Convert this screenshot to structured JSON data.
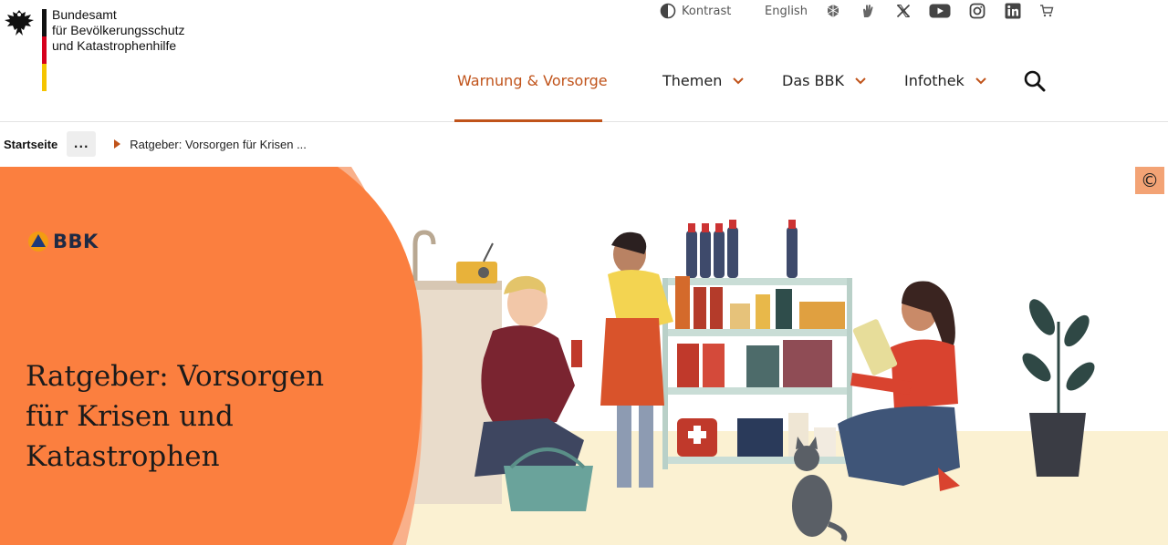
{
  "brand": {
    "line1": "Bundesamt",
    "line2": "für Bevölkerungsschutz",
    "line3": "und Katastrophenhilfe",
    "flag_colors": [
      "#111111",
      "#d6001c",
      "#f5c400"
    ]
  },
  "utility": {
    "contrast_label": "Kontrast",
    "language_label": "English",
    "icons": [
      "sign-language-icon",
      "hand-icon",
      "x-icon",
      "youtube-icon",
      "instagram-icon",
      "linkedin-icon",
      "cart-icon"
    ]
  },
  "nav": {
    "items": [
      {
        "label": "Warnung & Vorsorge",
        "active": true
      },
      {
        "label": "Themen",
        "active": false
      },
      {
        "label": "Das BBK",
        "active": false
      },
      {
        "label": "Infothek",
        "active": false
      }
    ],
    "accent": "#c0531a"
  },
  "breadcrumb": {
    "home": "Startseite",
    "more": "...",
    "current": "Ratgeber: Vorsorgen für Krisen ..."
  },
  "hero": {
    "copyright_symbol": "©",
    "logo_text": "BBK",
    "title_line1": "Ratgeber: Vorsorgen",
    "title_line2": "für Krisen und",
    "title_line3": "Katastrophen",
    "bg_orange": "#fb7f3f"
  }
}
